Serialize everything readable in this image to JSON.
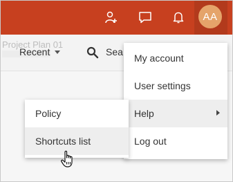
{
  "header": {
    "avatar_initials": "AA",
    "icons": [
      "add-user-icon",
      "chat-icon",
      "bell-icon"
    ]
  },
  "toolbar": {
    "ghost_title": "Project Plan 01",
    "recent_label": "Recent",
    "search_label": "Sea"
  },
  "user_menu": {
    "items": [
      {
        "label": "My account"
      },
      {
        "label": "User settings"
      },
      {
        "label": "Help"
      },
      {
        "label": "Log out"
      }
    ]
  },
  "help_menu": {
    "items": [
      {
        "label": "Policy"
      },
      {
        "label": "Shortcuts list"
      }
    ]
  },
  "colors": {
    "brand": "#c7401f",
    "avatar": "#e5a46a",
    "hover": "#eeeeee"
  }
}
